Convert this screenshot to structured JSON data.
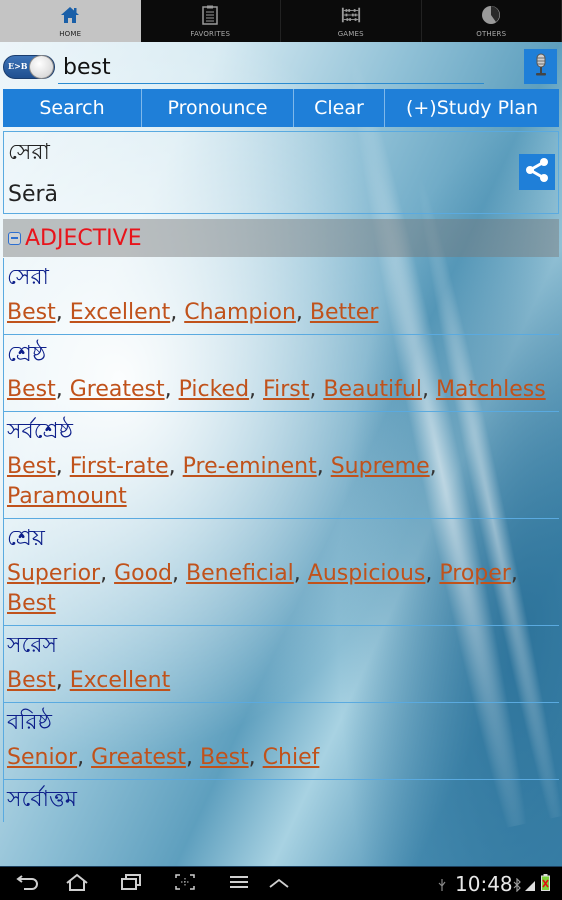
{
  "tabs": [
    {
      "label": "HOME",
      "icon": "home-icon",
      "active": true
    },
    {
      "label": "FAVORITES",
      "icon": "clipboard-icon",
      "active": false
    },
    {
      "label": "GAMES",
      "icon": "abacus-icon",
      "active": false
    },
    {
      "label": "OTHERS",
      "icon": "pie-icon",
      "active": false
    }
  ],
  "search": {
    "toggle_label": "E>B",
    "value": "best",
    "placeholder": ""
  },
  "actions": {
    "search": "Search",
    "pronounce": "Pronounce",
    "clear": "Clear",
    "study_plan": "(+)Study Plan"
  },
  "word": {
    "bangla": "সেরা",
    "transliteration": "Sērā"
  },
  "pos": {
    "label": "ADJECTIVE"
  },
  "entries": [
    {
      "bangla": "সেরা",
      "synonyms": [
        "Best",
        "Excellent",
        "Champion",
        "Better"
      ]
    },
    {
      "bangla": "শ্রেষ্ঠ",
      "synonyms": [
        "Best",
        "Greatest",
        "Picked",
        "First",
        "Beautiful",
        "Matchless"
      ]
    },
    {
      "bangla": "সর্বশ্রেষ্ঠ",
      "synonyms": [
        "Best",
        "First-rate",
        "Pre-eminent",
        "Supreme",
        "Paramount"
      ]
    },
    {
      "bangla": "শ্রেয়",
      "synonyms": [
        "Superior",
        "Good",
        "Beneficial",
        "Auspicious",
        "Proper",
        "Best"
      ]
    },
    {
      "bangla": "সরেস",
      "synonyms": [
        "Best",
        "Excellent"
      ]
    },
    {
      "bangla": "বরিষ্ঠ",
      "synonyms": [
        "Senior",
        "Greatest",
        "Best",
        "Chief"
      ]
    },
    {
      "bangla": "সর্বোত্তম",
      "synonyms": []
    }
  ],
  "statusbar": {
    "time": "10:48"
  },
  "colors": {
    "accent": "#1f7fd8",
    "pos_label": "#e8141b",
    "synonym_link": "#c0521b",
    "bangla_text": "#0d1f8a"
  }
}
